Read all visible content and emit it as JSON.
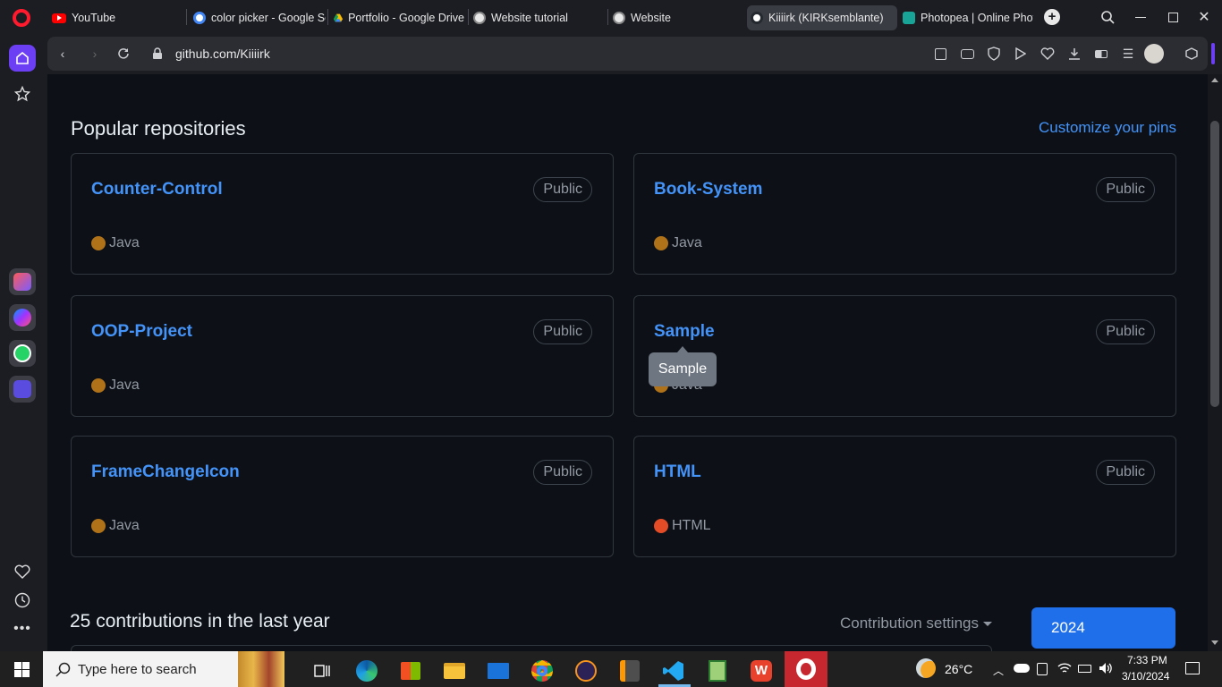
{
  "browser": {
    "tabs": [
      {
        "label": "YouTube",
        "icon": "youtube-icon"
      },
      {
        "label": "color picker - Google Se",
        "icon": "google-icon"
      },
      {
        "label": "Portfolio - Google Drive",
        "icon": "google-drive-icon"
      },
      {
        "label": "Website tutorial",
        "icon": "globe-icon"
      },
      {
        "label": "Website",
        "icon": "globe-icon"
      },
      {
        "label": "Kiiiirk (KIRKsemblante)",
        "icon": "github-icon",
        "active": true
      },
      {
        "label": "Photopea | Online Photo",
        "icon": "photopea-icon"
      }
    ],
    "url": "github.com/Kiiiirk"
  },
  "page": {
    "section_title": "Popular repositories",
    "customize_link": "Customize your pins",
    "repos": [
      {
        "name": "Counter-Control",
        "visibility": "Public",
        "language": "Java",
        "lang_color": "#b07219"
      },
      {
        "name": "Book-System",
        "visibility": "Public",
        "language": "Java",
        "lang_color": "#b07219"
      },
      {
        "name": "OOP-Project",
        "visibility": "Public",
        "language": "Java",
        "lang_color": "#b07219"
      },
      {
        "name": "Sample",
        "visibility": "Public",
        "language": "Java",
        "lang_color": "#b07219"
      },
      {
        "name": "FrameChangeIcon",
        "visibility": "Public",
        "language": "Java",
        "lang_color": "#b07219"
      },
      {
        "name": "HTML",
        "visibility": "Public",
        "language": "HTML",
        "lang_color": "#e34c26"
      }
    ],
    "tooltip": "Sample",
    "contributions_heading": "25 contributions in the last year",
    "contribution_settings": "Contribution settings",
    "year_button": "2024"
  },
  "taskbar": {
    "search_placeholder": "Type here to search",
    "weather": "26°C",
    "time": "7:33 PM",
    "date": "3/10/2024"
  },
  "colors": {
    "link": "#4493f8",
    "page_bg": "#0d1117",
    "border": "#30363d",
    "accent_sidebar": "#6c3ff5",
    "year_button": "#1f6feb"
  }
}
